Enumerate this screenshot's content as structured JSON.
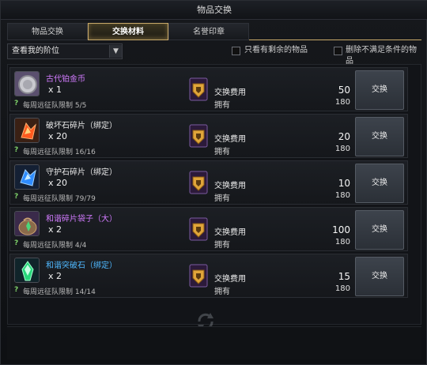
{
  "window": {
    "title": "物品交换"
  },
  "tabs": [
    {
      "label": "物品交换",
      "active": false
    },
    {
      "label": "交换材料",
      "active": true
    },
    {
      "label": "名誉印章",
      "active": false
    }
  ],
  "filters": {
    "rank_select": "查看我的阶位",
    "only_remaining": "只看有剩余的物品",
    "remove_unmet": "删除不满足条件的物品"
  },
  "rows": [
    {
      "name": "古代铂金币",
      "name_color": "#d27bff",
      "qty": "x 1",
      "limit": "每周远征队限制 5/5",
      "cost_label": "交换费用",
      "cost": "50",
      "own_label": "拥有",
      "own": "180",
      "button": "交换",
      "icon": "silver-coin-icon"
    },
    {
      "name": "破坏石碎片（绑定）",
      "name_color": "#f0f0f0",
      "qty": "x 20",
      "limit": "每周远征队限制 16/16",
      "cost_label": "交换费用",
      "cost": "20",
      "own_label": "拥有",
      "own": "180",
      "button": "交换",
      "icon": "red-crystal-icon"
    },
    {
      "name": "守护石碎片（绑定）",
      "name_color": "#f0f0f0",
      "qty": "x 20",
      "limit": "每周远征队限制 79/79",
      "cost_label": "交换费用",
      "cost": "10",
      "own_label": "拥有",
      "own": "180",
      "button": "交换",
      "icon": "blue-crystal-icon"
    },
    {
      "name": "和谐碎片袋子（大）",
      "name_color": "#d27bff",
      "qty": "x 2",
      "limit": "每周远征队限制 4/4",
      "cost_label": "交换费用",
      "cost": "100",
      "own_label": "拥有",
      "own": "180",
      "button": "交换",
      "icon": "shard-bag-icon"
    },
    {
      "name": "和谐突破石（绑定）",
      "name_color": "#4fb8ff",
      "qty": "x 2",
      "limit": "每周远征队限制 14/14",
      "cost_label": "交换费用",
      "cost": "15",
      "own_label": "拥有",
      "own": "180",
      "button": "交换",
      "icon": "green-crystal-icon"
    }
  ],
  "colors": {
    "accent_gold": "#c8a96a",
    "purple_name": "#d27bff",
    "blue_name": "#4fb8ff",
    "question_mark": "#7fd36a"
  }
}
